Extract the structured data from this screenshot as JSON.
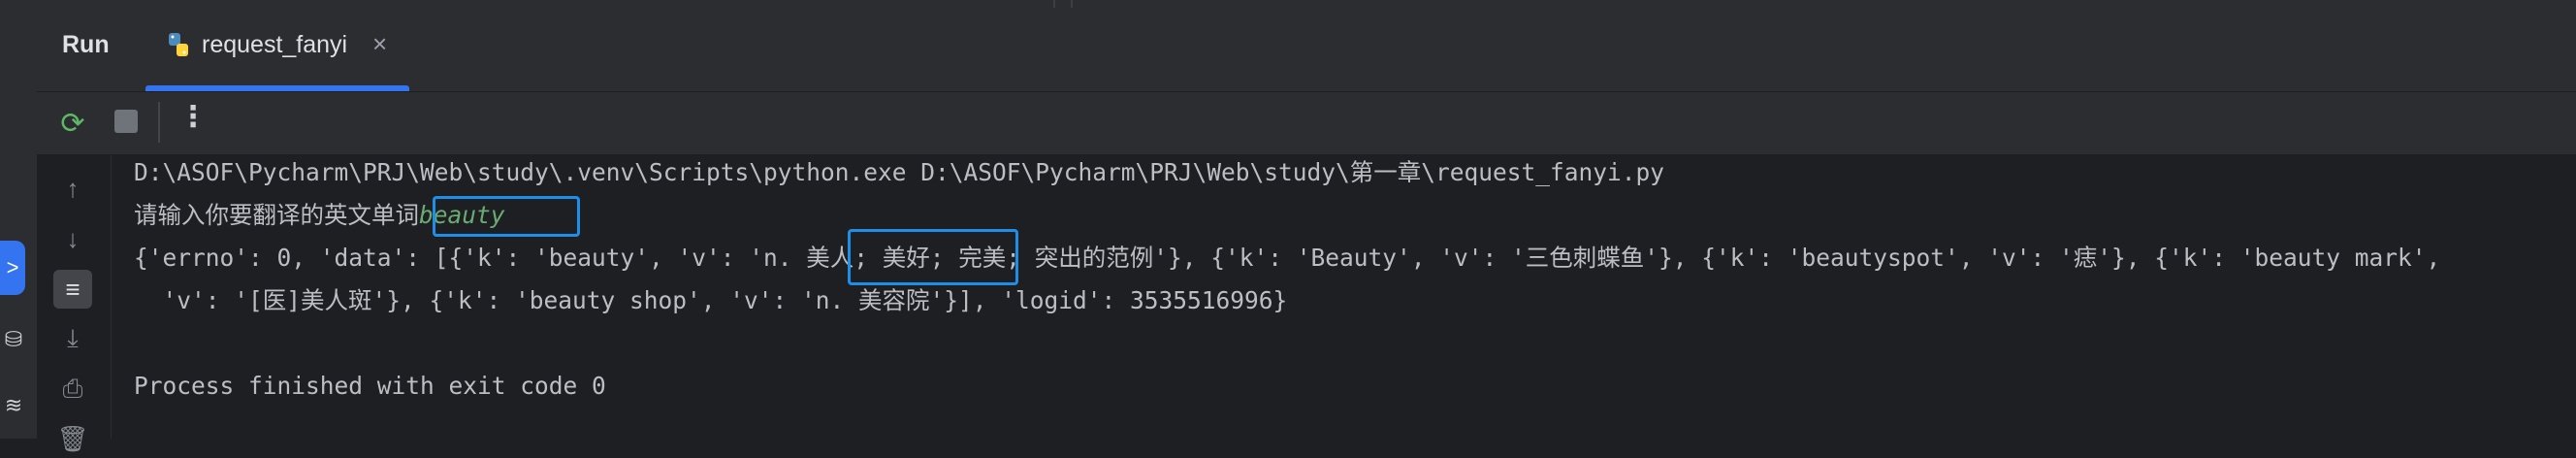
{
  "window": {
    "run_tool_label": "Run",
    "tab": {
      "title": "request_fanyi",
      "icon": "python-file-icon",
      "close_symbol": "×"
    }
  },
  "toolbar": {
    "rerun_icon": "rerun-icon",
    "stop_icon": "stop-icon",
    "more_symbol": "⋮"
  },
  "side_tools": [
    "up-arrow-icon",
    "down-arrow-icon",
    "soft-wrap-icon",
    "scroll-to-end-icon",
    "print-icon",
    "trash-icon"
  ],
  "console": {
    "command": "D:\\ASOF\\Pycharm\\PRJ\\Web\\study\\.venv\\Scripts\\python.exe D:\\ASOF\\Pycharm\\PRJ\\Web\\study\\第一章\\request_fanyi.py",
    "prompt": "请输入你要翻译的英文单词",
    "user_input": "beauty",
    "output_1_a": "{'errno': 0, 'data': [{'k': 'beauty', 'v': 'n.",
    "output_1_b": " 美人; 美好;",
    "output_1_c": " 完美; 突出的范例'}, {'k': 'Beauty', 'v': '三色刺蝶鱼'}, {'k': 'beautyspot', 'v': '痣'}, {'k': 'beauty mark',",
    "output_2": "  'v': '[医]美人斑'}, {'k': 'beauty shop', 'v': 'n. 美容院'}], 'logid': 3535516996}",
    "exit_line": "Process finished with exit code 0"
  },
  "colors": {
    "accent": "#3574f0",
    "highlight_box": "#1f8ee8",
    "input_text": "#6aab73",
    "background": "#1e1f22"
  }
}
